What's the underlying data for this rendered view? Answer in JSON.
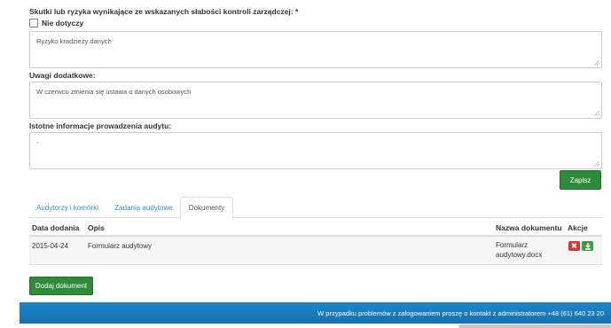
{
  "form": {
    "risk_label": "Skutki lub ryzyka wynikające ze wskazanych słabości kontroli zarządczej: *",
    "not_applicable_label": "Nie dotyczy",
    "risk_value": "Ryzyko kradzieży danych",
    "notes_label": "Uwagi dodatkowe:",
    "notes_value": "W czerwcu zmienia się ustawa o danych osobowych",
    "audit_info_label": "Istotne informacje prowadzenia audytu:",
    "audit_info_value": "-",
    "save_label": "Zapisz"
  },
  "tabs": [
    {
      "label": "Audytorzy i komórki",
      "active": false
    },
    {
      "label": "Zadania audytowe",
      "active": false
    },
    {
      "label": "Dokumenty",
      "active": true
    }
  ],
  "documents": {
    "headers": {
      "date": "Data dodania",
      "description": "Opis",
      "name": "Nazwa dokumentu",
      "actions": "Akcje"
    },
    "rows": [
      {
        "date": "2015-04-24",
        "description": "Formularz audytowy",
        "name_line1": "Formularz",
        "name_line2": "audytowy.docx"
      }
    ],
    "add_label": "Dodaj dokument"
  },
  "footer": {
    "text": "W przypadku problemów z zalogowaniem proszę o kontakt z administratorem +48 (61) 640 23 20"
  },
  "colors": {
    "primary_green": "#2f8a3a",
    "danger_red": "#d9362f",
    "footer_blue": "#1f86c8",
    "tab_link": "#3a8fc7"
  }
}
